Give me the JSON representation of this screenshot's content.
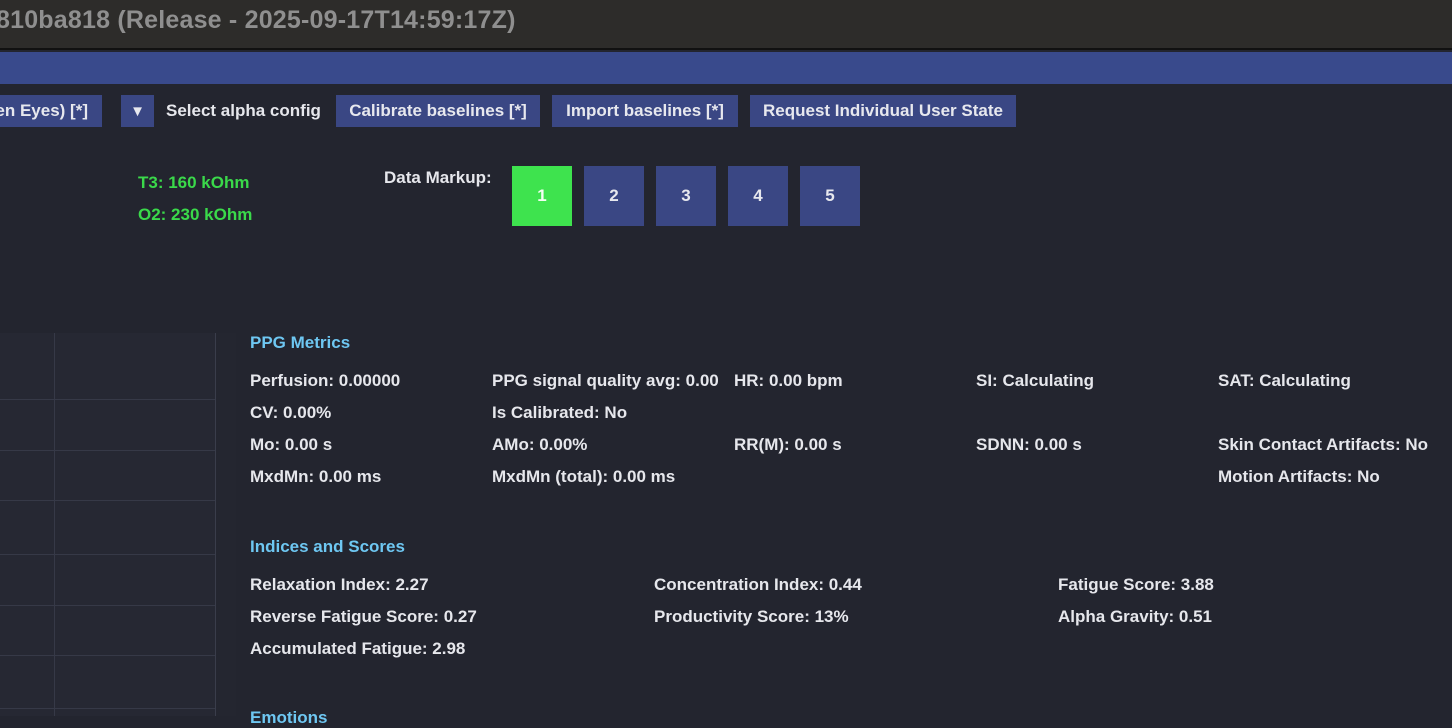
{
  "window": {
    "title": "810ba818 (Release - 2025-09-17T14:59:17Z)"
  },
  "toolbar": {
    "eyes_button": "en Eyes) [*]",
    "dropdown_glyph": "▼",
    "alpha_config_label": "Select alpha config",
    "calibrate_baselines": "Calibrate baselines [*]",
    "import_baselines": "Import baselines [*]",
    "request_state": "Request Individual User State"
  },
  "impedance": {
    "t3": "T3: 160 kOhm",
    "o2": "O2: 230 kOhm",
    "color": "#3ad94a"
  },
  "data_markup": {
    "label": "Data Markup:",
    "buttons": [
      "1",
      "2",
      "3",
      "4",
      "5"
    ],
    "active_index": 0,
    "active_color": "#3ee34e"
  },
  "ppg": {
    "title": "PPG Metrics",
    "rows": [
      [
        "Perfusion: 0.00000",
        "PPG signal quality avg: 0.00",
        "HR: 0.00 bpm",
        "SI: Calculating",
        "SAT: Calculating"
      ],
      [
        "CV: 0.00%",
        "Is Calibrated: No",
        "",
        "",
        ""
      ],
      [
        "Mo: 0.00 s",
        "AMo: 0.00%",
        "RR(M): 0.00 s",
        "SDNN: 0.00 s",
        "Skin Contact Artifacts: No"
      ],
      [
        "MxdMn: 0.00 ms",
        "MxdMn (total): 0.00 ms",
        "",
        "",
        "Motion Artifacts: No"
      ]
    ]
  },
  "indices": {
    "title": "Indices and Scores",
    "rows": [
      [
        "Relaxation Index: 2.27",
        "Concentration Index: 0.44",
        "Fatigue Score: 3.88"
      ],
      [
        "Reverse Fatigue Score: 0.27",
        "Productivity Score: 13%",
        "Alpha Gravity: 0.51"
      ],
      [
        "Accumulated Fatigue: 2.98",
        "",
        ""
      ]
    ]
  },
  "emotions": {
    "title": "Emotions"
  },
  "colors": {
    "background": "#23252f",
    "accent": "#3a4784",
    "section_title": "#6ec7f2"
  }
}
